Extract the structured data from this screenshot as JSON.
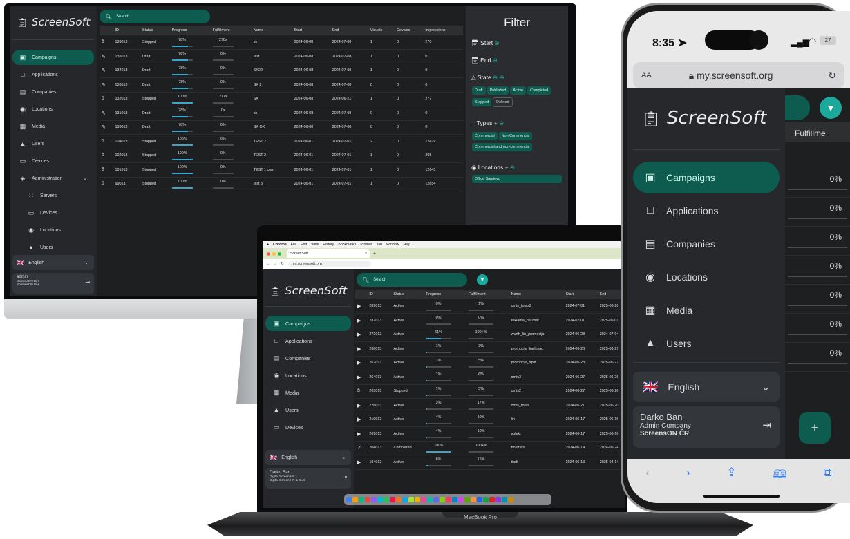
{
  "app": {
    "logo": "ScreenSoft"
  },
  "monitor": {
    "search_placeholder": "Search",
    "nav": [
      {
        "label": "Campaigns",
        "icon": "campaigns-icon",
        "active": true
      },
      {
        "label": "Applications",
        "icon": "applications-icon"
      },
      {
        "label": "Companies",
        "icon": "companies-icon"
      },
      {
        "label": "Locations",
        "icon": "location-pin-icon"
      },
      {
        "label": "Media",
        "icon": "media-icon"
      },
      {
        "label": "Users",
        "icon": "user-icon"
      },
      {
        "label": "Devices",
        "icon": "devices-icon"
      },
      {
        "label": "Administration",
        "icon": "shield-icon"
      },
      {
        "label": "Servers",
        "icon": "servers-icon",
        "sub": true
      },
      {
        "label": "Devices",
        "icon": "devices-icon",
        "sub": true
      },
      {
        "label": "Locations",
        "icon": "location-pin-icon",
        "sub": true
      },
      {
        "label": "Users",
        "icon": "user-icon",
        "sub": true
      }
    ],
    "language": "English",
    "user": {
      "name": "admin",
      "company": "ScreensON BiH",
      "org": "ScreensON BiH"
    },
    "columns": [
      "ID",
      "Status",
      "Progress",
      "Fulfillment",
      "Name",
      "Start",
      "End",
      "Visuals",
      "Devices",
      "Impressions"
    ],
    "rows": [
      {
        "icon": "hand",
        "id": "136013",
        "status": "Stopped",
        "progress": "78%",
        "pfill": 0.78,
        "fulfillment": "270x",
        "name": "sk",
        "start": "2024-06-08",
        "end": "2024-07-08",
        "visuals": "1",
        "devices": "0",
        "impressions": "270"
      },
      {
        "icon": "pencil",
        "id": "135013",
        "status": "Draft",
        "progress": "78%",
        "pfill": 0.78,
        "fulfillment": "0%",
        "name": "test",
        "start": "2024-06-08",
        "end": "2024-07-08",
        "visuals": "1",
        "devices": "0",
        "impressions": "0"
      },
      {
        "icon": "pencil",
        "id": "134013",
        "status": "Draft",
        "progress": "78%",
        "pfill": 0.78,
        "fulfillment": "0%",
        "name": "SK22",
        "start": "2024-06-08",
        "end": "2024-07-08",
        "visuals": "1",
        "devices": "0",
        "impressions": "0"
      },
      {
        "icon": "pencil",
        "id": "133013",
        "status": "Draft",
        "progress": "78%",
        "pfill": 0.78,
        "fulfillment": "0%",
        "name": "SK 2",
        "start": "2024-06-08",
        "end": "2024-07-08",
        "visuals": "0",
        "devices": "0",
        "impressions": "0"
      },
      {
        "icon": "hand",
        "id": "132013",
        "status": "Stopped",
        "progress": "100%",
        "pfill": 1.0,
        "fulfillment": "277x",
        "name": "SK",
        "start": "2024-06-08",
        "end": "2024-06-21",
        "visuals": "1",
        "devices": "0",
        "impressions": "277"
      },
      {
        "icon": "pencil",
        "id": "131013",
        "status": "Draft",
        "progress": "78%",
        "pfill": 0.78,
        "fulfillment": "0x",
        "name": "sk",
        "start": "2024-06-08",
        "end": "2024-07-08",
        "visuals": "0",
        "devices": "0",
        "impressions": "0"
      },
      {
        "icon": "pencil",
        "id": "130013",
        "status": "Draft",
        "progress": "78%",
        "pfill": 0.78,
        "fulfillment": "0%",
        "name": "SK OK",
        "start": "2024-06-08",
        "end": "2024-07-08",
        "visuals": "0",
        "devices": "0",
        "impressions": "0"
      },
      {
        "icon": "hand",
        "id": "104013",
        "status": "Stopped",
        "progress": "100%",
        "pfill": 1.0,
        "fulfillment": "0%",
        "name": "TEST 2",
        "start": "2024-06-01",
        "end": "2024-07-01",
        "visuals": "2",
        "devices": "0",
        "impressions": "12429"
      },
      {
        "icon": "hand",
        "id": "102013",
        "status": "Stopped",
        "progress": "100%",
        "pfill": 1.0,
        "fulfillment": "0%",
        "name": "TEST 2",
        "start": "2024-06-01",
        "end": "2024-07-01",
        "visuals": "1",
        "devices": "0",
        "impressions": "208"
      },
      {
        "icon": "hand",
        "id": "101013",
        "status": "Stopped",
        "progress": "100%",
        "pfill": 1.0,
        "fulfillment": "0%",
        "name": "TEST 1 com",
        "start": "2024-06-01",
        "end": "2024-07-01",
        "visuals": "1",
        "devices": "0",
        "impressions": "12645"
      },
      {
        "icon": "hand",
        "id": "99013",
        "status": "Stopped",
        "progress": "100%",
        "pfill": 1.0,
        "fulfillment": "0%",
        "name": "test 3",
        "start": "2024-06-01",
        "end": "2024-07-01",
        "visuals": "1",
        "devices": "0",
        "impressions": "12654"
      }
    ],
    "filter": {
      "title": "Filter",
      "start_label": "Start",
      "end_label": "End",
      "state_label": "State",
      "states": [
        {
          "label": "Draft",
          "on": true
        },
        {
          "label": "Published",
          "on": true
        },
        {
          "label": "Active",
          "on": true
        },
        {
          "label": "Completed",
          "on": true
        },
        {
          "label": "Stopped",
          "on": true
        },
        {
          "label": "Deleted",
          "on": false
        }
      ],
      "types_label": "Types",
      "types": [
        "Commercial",
        "Non Commercial",
        "Commercial and non-commercial"
      ],
      "locations_label": "Locations",
      "locations": [
        "Office Sarajevo"
      ]
    }
  },
  "laptop": {
    "menubar": [
      "Chrome",
      "File",
      "Edit",
      "View",
      "History",
      "Bookmarks",
      "Profiles",
      "Tab",
      "Window",
      "Help"
    ],
    "tab_title": "ScreenSoft",
    "url": "my.screensoft.org",
    "search_placeholder": "Search",
    "device_label": "MacBook Pro",
    "nav": [
      {
        "label": "Campaigns",
        "icon": "campaigns-icon",
        "active": true
      },
      {
        "label": "Applications",
        "icon": "applications-icon"
      },
      {
        "label": "Companies",
        "icon": "companies-icon"
      },
      {
        "label": "Locations",
        "icon": "location-pin-icon"
      },
      {
        "label": "Media",
        "icon": "media-icon"
      },
      {
        "label": "Users",
        "icon": "user-icon"
      },
      {
        "label": "Devices",
        "icon": "devices-icon"
      }
    ],
    "language": "English",
    "user": {
      "name": "Darko Ban",
      "company": "Digital Screen HR",
      "org": "Digital Screen HR & SLO"
    },
    "columns": [
      "ID",
      "Status",
      "Progress",
      "Fulfillment",
      "Name",
      "Start",
      "End"
    ],
    "rows": [
      {
        "icon": "play",
        "id": "289013",
        "status": "Active",
        "progress": "0%",
        "pfill": 0.0,
        "fulfillment": "1%",
        "name": "omis_tours2",
        "start": "2024-07-01",
        "end": "2025-06-26"
      },
      {
        "icon": "play",
        "id": "287013",
        "status": "Active",
        "progress": "0%",
        "pfill": 0.0,
        "fulfillment": "0%",
        "name": "reklama_baumar",
        "start": "2024-07-01",
        "end": "2025-06-01"
      },
      {
        "icon": "play",
        "id": "272013",
        "status": "Active",
        "progress": "61%",
        "pfill": 0.61,
        "fulfillment": "100+%",
        "name": "wurth_lin_promocija",
        "start": "2024-06-28",
        "end": "2024-07-04"
      },
      {
        "icon": "play",
        "id": "268013",
        "status": "Active",
        "progress": "1%",
        "pfill": 0.01,
        "fulfillment": "3%",
        "name": "promocija_karlovac",
        "start": "2024-06-28",
        "end": "2025-06-27"
      },
      {
        "icon": "play",
        "id": "267013",
        "status": "Active",
        "progress": "1%",
        "pfill": 0.01,
        "fulfillment": "5%",
        "name": "promocija_split",
        "start": "2024-06-28",
        "end": "2025-06-27"
      },
      {
        "icon": "play",
        "id": "264013",
        "status": "Active",
        "progress": "1%",
        "pfill": 0.01,
        "fulfillment": "6%",
        "name": "omis3",
        "start": "2024-06-27",
        "end": "2025-06-26"
      },
      {
        "icon": "hand",
        "id": "263013",
        "status": "Stopped",
        "progress": "1%",
        "pfill": 0.01,
        "fulfillment": "5%",
        "name": "omis2",
        "start": "2024-06-27",
        "end": "2025-06-26"
      },
      {
        "icon": "play",
        "id": "226013",
        "status": "Active",
        "progress": "3%",
        "pfill": 0.03,
        "fulfillment": "17%",
        "name": "omis_tours",
        "start": "2024-06-21",
        "end": "2025-06-20"
      },
      {
        "icon": "play",
        "id": "210013",
        "status": "Active",
        "progress": "4%",
        "pfill": 0.04,
        "fulfillment": "10%",
        "name": "lin",
        "start": "2024-06-17",
        "end": "2025-06-16"
      },
      {
        "icon": "play",
        "id": "209013",
        "status": "Active",
        "progress": "4%",
        "pfill": 0.04,
        "fulfillment": "10%",
        "name": "solekt",
        "start": "2024-06-17",
        "end": "2025-06-16"
      },
      {
        "icon": "check",
        "id": "204013",
        "status": "Completed",
        "progress": "100%",
        "pfill": 1.0,
        "fulfillment": "100+%",
        "name": "hrvatska",
        "start": "2024-06-14",
        "end": "2024-06-24"
      },
      {
        "icon": "play",
        "id": "194013",
        "status": "Active",
        "progress": "6%",
        "pfill": 0.06,
        "fulfillment": "15%",
        "name": "čarli",
        "start": "2024-06-13",
        "end": "2025-04-14"
      }
    ]
  },
  "phone": {
    "time": "8:35",
    "battery": "27",
    "text_size": "AA",
    "url": "my.screensoft.org",
    "header_col": "Fulfillme",
    "nav": [
      {
        "label": "Campaigns",
        "icon": "campaigns-icon",
        "active": true
      },
      {
        "label": "Applications",
        "icon": "applications-icon"
      },
      {
        "label": "Companies",
        "icon": "companies-icon"
      },
      {
        "label": "Locations",
        "icon": "location-pin-icon"
      },
      {
        "label": "Media",
        "icon": "media-icon"
      },
      {
        "label": "Users",
        "icon": "user-icon"
      }
    ],
    "language": "English",
    "user": {
      "name": "Darko Ban",
      "company": "Admin Company",
      "org": "ScreensON ČR"
    },
    "fulfillment_values": [
      "0%",
      "0%",
      "0%",
      "0%",
      "0%",
      "0%",
      "0%"
    ],
    "fab": "+"
  },
  "colors": {
    "accent": "#0d5c4f",
    "teal": "#1aa99a",
    "progress": "#3aa6d0"
  }
}
